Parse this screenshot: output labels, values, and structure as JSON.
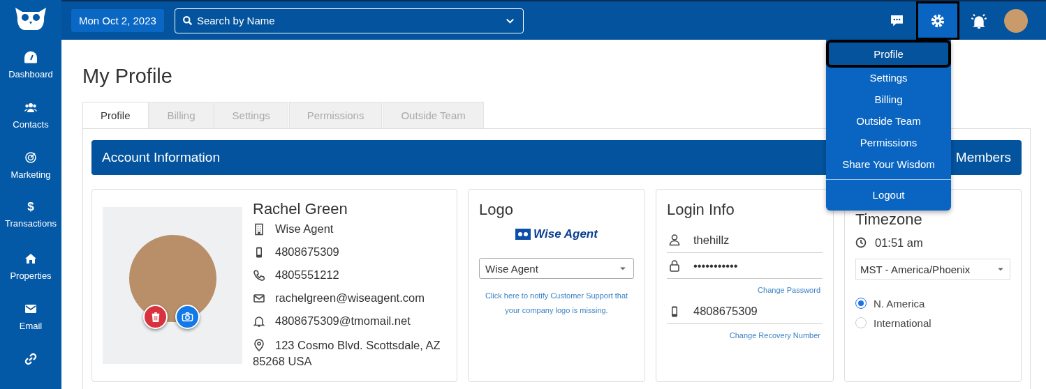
{
  "header": {
    "date": "Mon Oct 2, 2023",
    "search": {
      "placeholder": "Search by Name"
    },
    "settings_open": true
  },
  "sidebar": {
    "items": [
      {
        "kind": "gauge",
        "label": "Dashboard"
      },
      {
        "kind": "users",
        "label": "Contacts"
      },
      {
        "kind": "target",
        "label": "Marketing"
      },
      {
        "kind": "dollar",
        "symbol": "$",
        "label": "Transactions"
      },
      {
        "kind": "home",
        "label": "Properties"
      },
      {
        "kind": "envelope",
        "label": "Email"
      },
      {
        "kind": "link"
      }
    ]
  },
  "settings_menu": {
    "items": [
      {
        "label": "Profile",
        "selected": true
      },
      {
        "label": "Settings",
        "selected": false
      },
      {
        "label": "Billing",
        "selected": false
      },
      {
        "label": "Outside Team",
        "selected": false
      },
      {
        "label": "Permissions",
        "selected": false
      },
      {
        "label": "Share Your Wisdom",
        "selected": false
      }
    ],
    "logout": "Logout"
  },
  "page": {
    "title": "My Profile",
    "tabs": [
      {
        "label": "Profile",
        "selected": true
      },
      {
        "label": "Billing",
        "selected": false
      },
      {
        "label": "Settings",
        "selected": false
      },
      {
        "label": "Permissions",
        "selected": false
      },
      {
        "label": "Outside Team",
        "selected": false
      }
    ]
  },
  "account_bar": {
    "title": "Account Information",
    "button": "Members"
  },
  "profile_card": {
    "name": "Rachel Green",
    "details": [
      {
        "kind": "building",
        "text": "Wise Agent"
      },
      {
        "kind": "mobile",
        "text": "4808675309"
      },
      {
        "kind": "phone",
        "text": "4805551212"
      },
      {
        "kind": "envelope",
        "text": "rachelgreen@wiseagent.com"
      },
      {
        "kind": "bell",
        "text": "4808675309@tmomail.net"
      },
      {
        "kind": "pin",
        "text": "123 Cosmo Blvd. Scottsdale, AZ 85268 USA"
      }
    ]
  },
  "logo_card": {
    "title": "Logo",
    "logo_text": "Wise Agent",
    "select": "Wise Agent",
    "notice": "Click here to notify Customer Support that your company logo is missing."
  },
  "login_card": {
    "title": "Login Info",
    "username": "thehillz",
    "password": "•••••••••••",
    "change_password": "Change Password",
    "phone": "4808675309",
    "change_recovery": "Change Recovery Number"
  },
  "timezone_card": {
    "title": "Timezone",
    "time": "01:51 am",
    "zone": "MST - America/Phoenix",
    "regions": [
      {
        "label": "N. America",
        "selected": true
      },
      {
        "label": "International",
        "selected": false
      }
    ]
  }
}
